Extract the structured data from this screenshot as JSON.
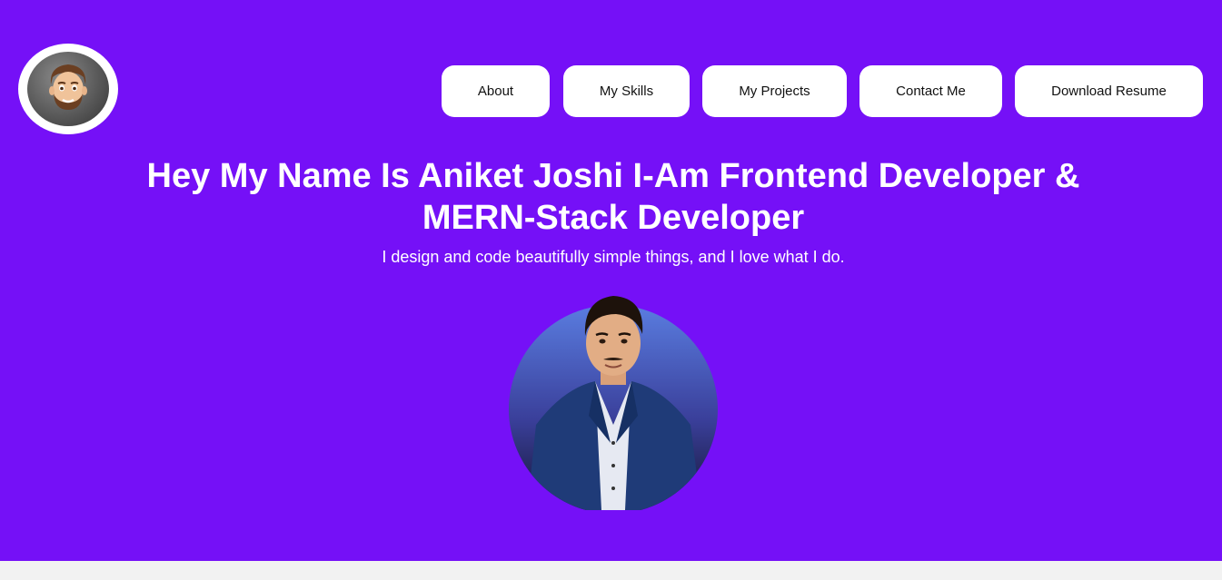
{
  "header": {
    "logo_icon": "memoji-avatar-icon",
    "nav": [
      {
        "label": "About"
      },
      {
        "label": "My Skills"
      },
      {
        "label": "My Projects"
      },
      {
        "label": "Contact Me"
      },
      {
        "label": "Download Resume"
      }
    ]
  },
  "hero": {
    "headline_line1": "Hey My Name Is Aniket Joshi I-Am Frontend Developer &",
    "headline_line2": "MERN-Stack Developer",
    "tagline": "I design and code beautifully simple things, and I love what I do.",
    "portrait_icon": "profile-photo"
  },
  "colors": {
    "hero_bg": "#7510f7",
    "button_bg": "#ffffff",
    "page_bg": "#f2f2f2"
  }
}
